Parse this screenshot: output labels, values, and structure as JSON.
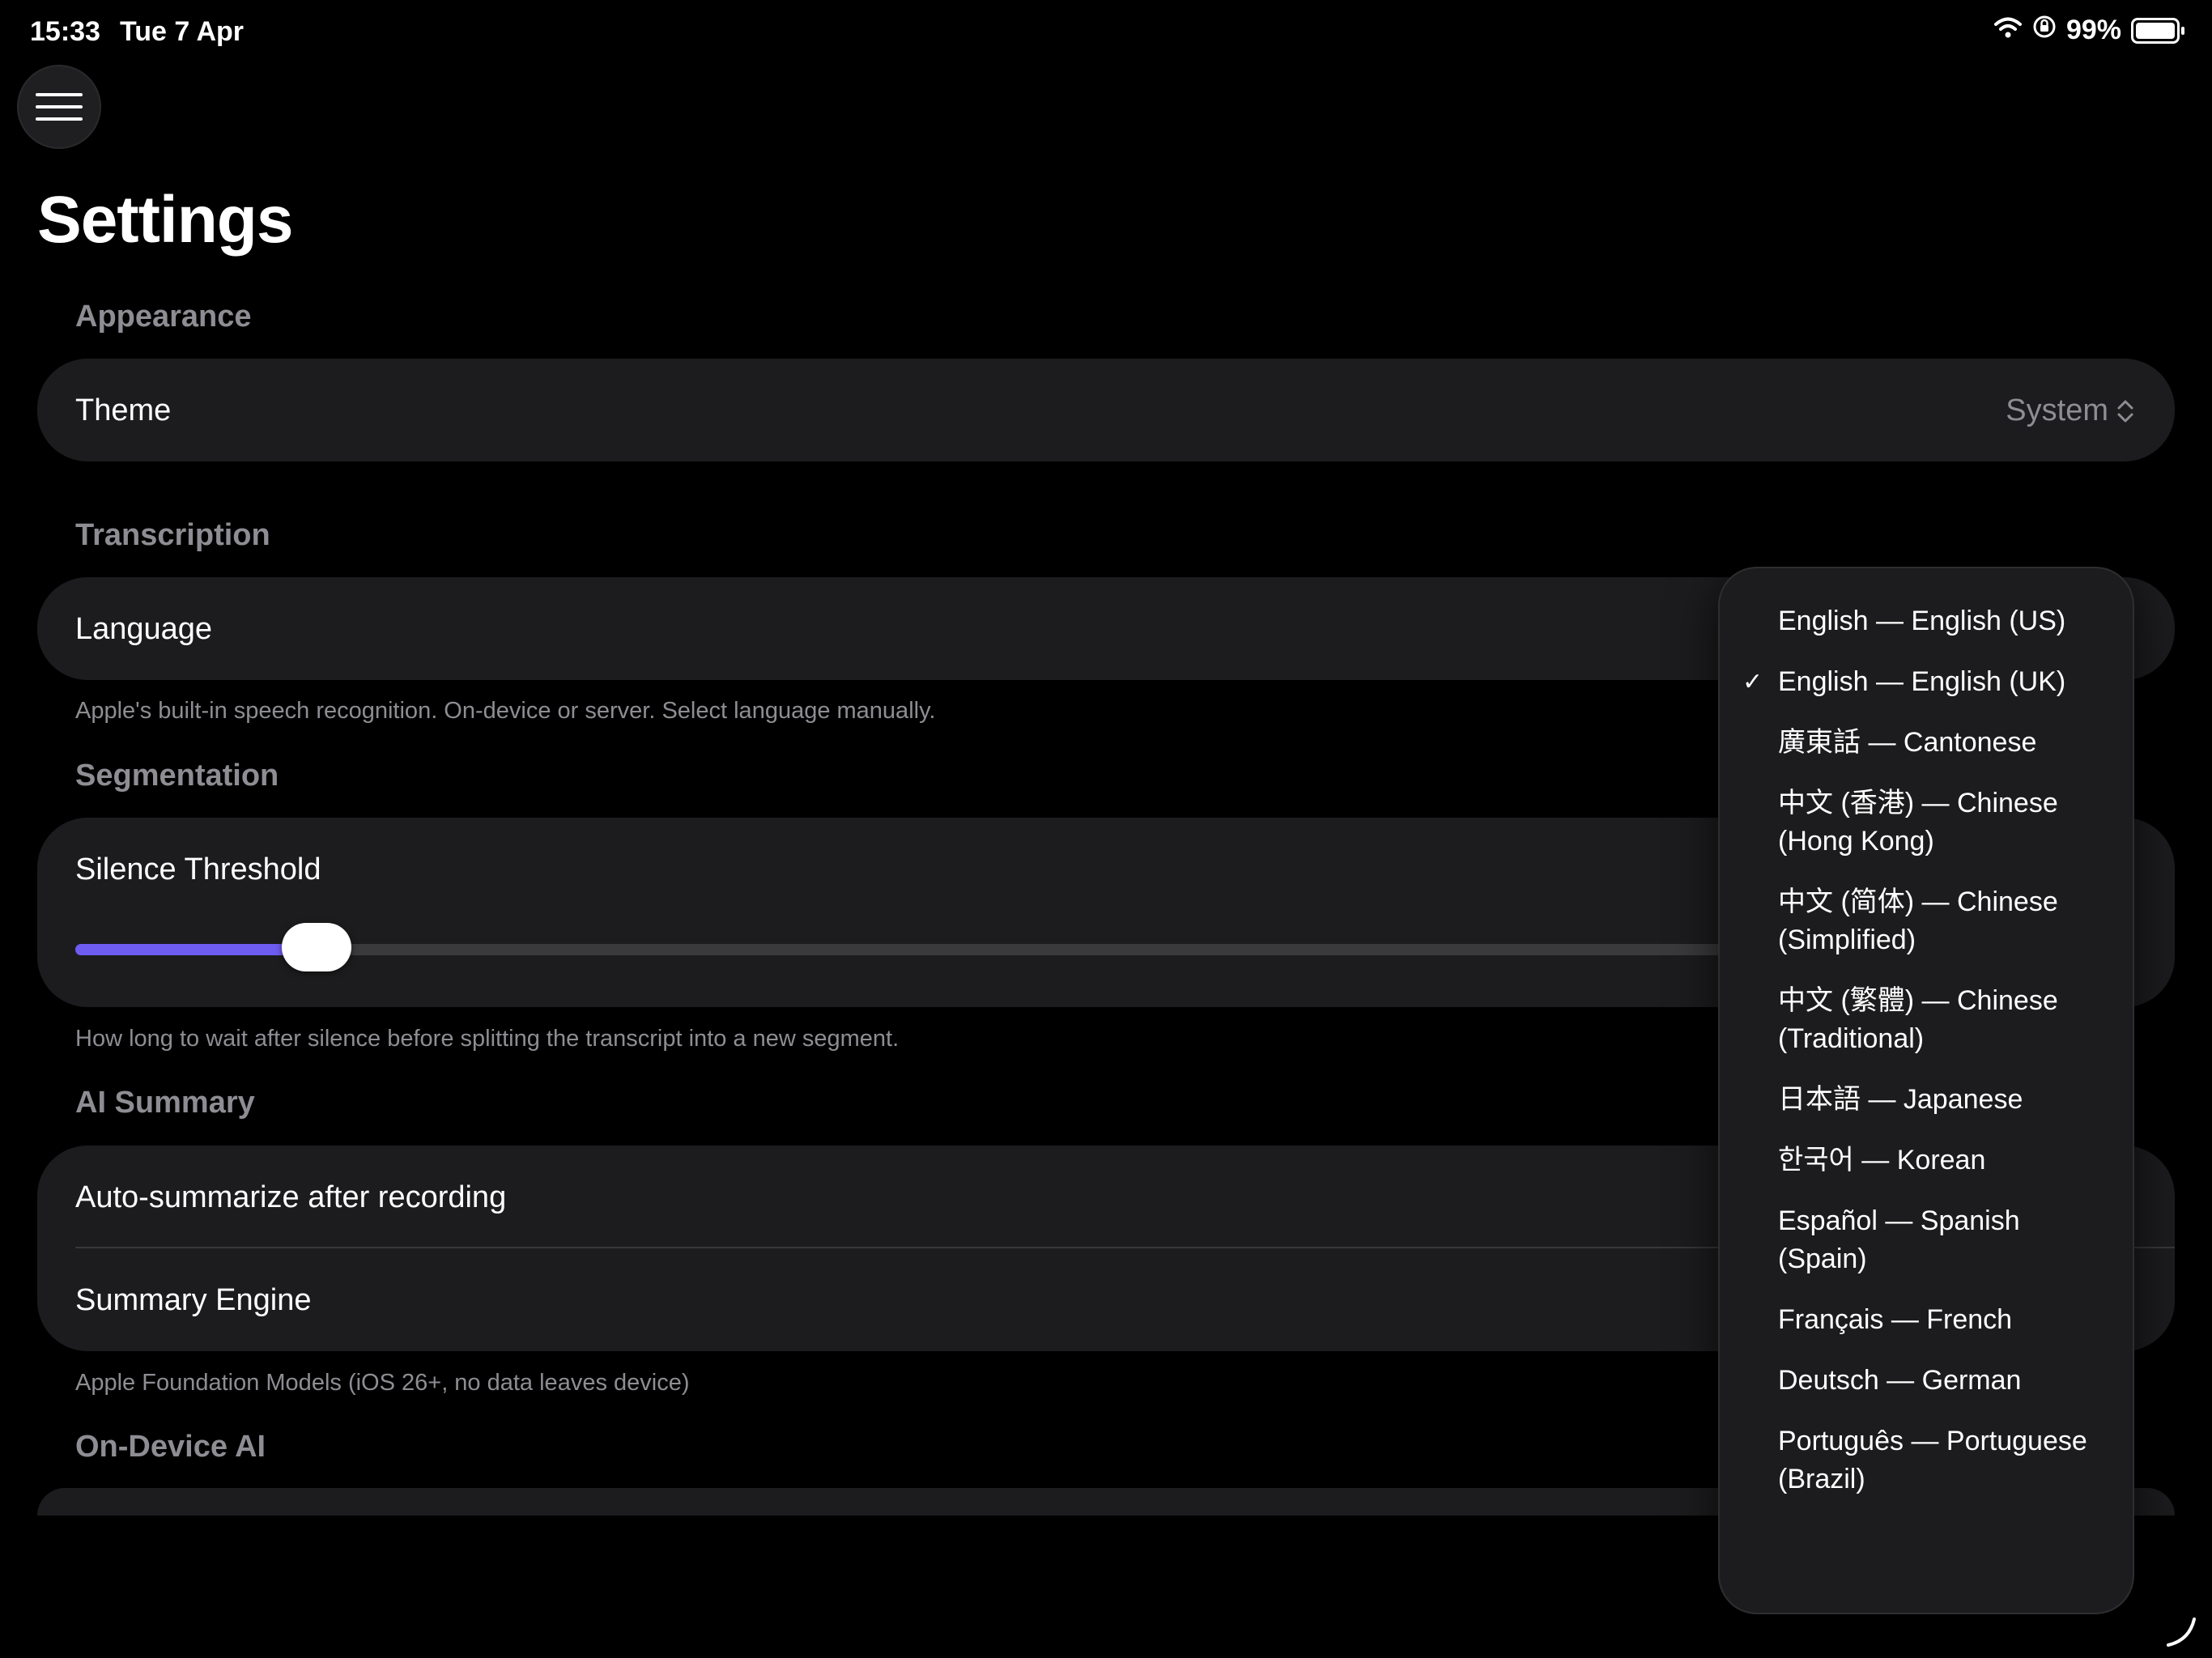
{
  "status_bar": {
    "time": "15:33",
    "date": "Tue 7 Apr",
    "battery": "99%"
  },
  "page_title": "Settings",
  "appearance": {
    "header": "Appearance",
    "theme_label": "Theme",
    "theme_value": "System"
  },
  "transcription": {
    "header": "Transcription",
    "language_label": "Language",
    "footnote": "Apple's built-in speech recognition. On-device or server. Select language manually."
  },
  "segmentation": {
    "header": "Segmentation",
    "silence_label": "Silence Threshold",
    "slider_fraction": 0.12,
    "footnote": "How long to wait after silence before splitting the transcript into a new segment."
  },
  "ai_summary": {
    "header": "AI Summary",
    "auto_label": "Auto-summarize after recording",
    "engine_label": "Summary Engine",
    "footnote": "Apple Foundation Models (iOS 26+, no data leaves device)"
  },
  "on_device_ai": {
    "header": "On-Device AI"
  },
  "language_menu": {
    "check_glyph": "✓",
    "options": [
      {
        "label": "English — English (US)",
        "selected": false
      },
      {
        "label": "English — English (UK)",
        "selected": true
      },
      {
        "label": "廣東話 — Cantonese",
        "selected": false
      },
      {
        "label": "中文 (香港) — Chinese (Hong Kong)",
        "selected": false
      },
      {
        "label": "中文 (简体) — Chinese (Simplified)",
        "selected": false
      },
      {
        "label": "中文 (繁體) — Chinese (Traditional)",
        "selected": false
      },
      {
        "label": "日本語 — Japanese",
        "selected": false
      },
      {
        "label": "한국어 — Korean",
        "selected": false
      },
      {
        "label": "Español — Spanish (Spain)",
        "selected": false
      },
      {
        "label": "Français — French",
        "selected": false
      },
      {
        "label": "Deutsch — German",
        "selected": false
      },
      {
        "label": "Português — Portuguese (Brazil)",
        "selected": false
      }
    ]
  },
  "colors": {
    "accent": "#6e5cf0",
    "card": "#1c1c1e",
    "secondary_text": "#8d8d93"
  },
  "icons": [
    "wifi-icon",
    "orientation-lock-icon",
    "battery-icon",
    "hamburger-menu-icon",
    "chevron-up-down-icon",
    "checkmark-icon"
  ]
}
